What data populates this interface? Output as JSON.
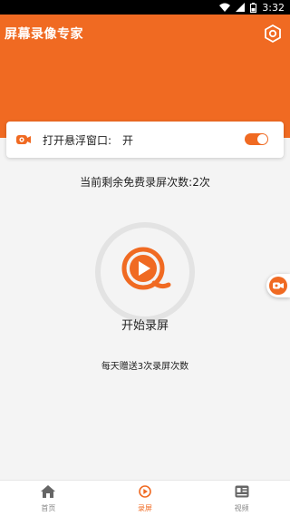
{
  "status_bar": {
    "time": "3:32"
  },
  "header": {
    "title": "屏幕录像专家"
  },
  "float_window": {
    "label": "打开悬浮窗口:",
    "state": "开",
    "enabled": true
  },
  "remaining": {
    "text": "当前剩余免费录屏次数:2次"
  },
  "record": {
    "label": "开始录屏"
  },
  "daily": {
    "text": "每天赠送3次录屏次数"
  },
  "bottom_nav": {
    "items": [
      {
        "label": "首页",
        "icon": "home-icon",
        "active": false
      },
      {
        "label": "录屏",
        "icon": "record-icon",
        "active": true
      },
      {
        "label": "视频",
        "icon": "video-icon",
        "active": false
      }
    ]
  },
  "colors": {
    "accent": "#f06a22",
    "background": "#f4f4f4"
  }
}
